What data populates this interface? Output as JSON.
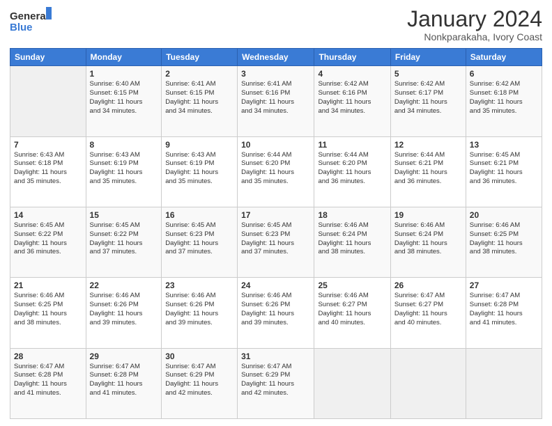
{
  "header": {
    "logo_line1": "General",
    "logo_line2": "Blue",
    "month_title": "January 2024",
    "subtitle": "Nonkparakaha, Ivory Coast"
  },
  "weekdays": [
    "Sunday",
    "Monday",
    "Tuesday",
    "Wednesday",
    "Thursday",
    "Friday",
    "Saturday"
  ],
  "weeks": [
    [
      {
        "day": "",
        "info": ""
      },
      {
        "day": "1",
        "info": "Sunrise: 6:40 AM\nSunset: 6:15 PM\nDaylight: 11 hours\nand 34 minutes."
      },
      {
        "day": "2",
        "info": "Sunrise: 6:41 AM\nSunset: 6:15 PM\nDaylight: 11 hours\nand 34 minutes."
      },
      {
        "day": "3",
        "info": "Sunrise: 6:41 AM\nSunset: 6:16 PM\nDaylight: 11 hours\nand 34 minutes."
      },
      {
        "day": "4",
        "info": "Sunrise: 6:42 AM\nSunset: 6:16 PM\nDaylight: 11 hours\nand 34 minutes."
      },
      {
        "day": "5",
        "info": "Sunrise: 6:42 AM\nSunset: 6:17 PM\nDaylight: 11 hours\nand 34 minutes."
      },
      {
        "day": "6",
        "info": "Sunrise: 6:42 AM\nSunset: 6:18 PM\nDaylight: 11 hours\nand 35 minutes."
      }
    ],
    [
      {
        "day": "7",
        "info": "Sunrise: 6:43 AM\nSunset: 6:18 PM\nDaylight: 11 hours\nand 35 minutes."
      },
      {
        "day": "8",
        "info": "Sunrise: 6:43 AM\nSunset: 6:19 PM\nDaylight: 11 hours\nand 35 minutes."
      },
      {
        "day": "9",
        "info": "Sunrise: 6:43 AM\nSunset: 6:19 PM\nDaylight: 11 hours\nand 35 minutes."
      },
      {
        "day": "10",
        "info": "Sunrise: 6:44 AM\nSunset: 6:20 PM\nDaylight: 11 hours\nand 35 minutes."
      },
      {
        "day": "11",
        "info": "Sunrise: 6:44 AM\nSunset: 6:20 PM\nDaylight: 11 hours\nand 36 minutes."
      },
      {
        "day": "12",
        "info": "Sunrise: 6:44 AM\nSunset: 6:21 PM\nDaylight: 11 hours\nand 36 minutes."
      },
      {
        "day": "13",
        "info": "Sunrise: 6:45 AM\nSunset: 6:21 PM\nDaylight: 11 hours\nand 36 minutes."
      }
    ],
    [
      {
        "day": "14",
        "info": "Sunrise: 6:45 AM\nSunset: 6:22 PM\nDaylight: 11 hours\nand 36 minutes."
      },
      {
        "day": "15",
        "info": "Sunrise: 6:45 AM\nSunset: 6:22 PM\nDaylight: 11 hours\nand 37 minutes."
      },
      {
        "day": "16",
        "info": "Sunrise: 6:45 AM\nSunset: 6:23 PM\nDaylight: 11 hours\nand 37 minutes."
      },
      {
        "day": "17",
        "info": "Sunrise: 6:45 AM\nSunset: 6:23 PM\nDaylight: 11 hours\nand 37 minutes."
      },
      {
        "day": "18",
        "info": "Sunrise: 6:46 AM\nSunset: 6:24 PM\nDaylight: 11 hours\nand 38 minutes."
      },
      {
        "day": "19",
        "info": "Sunrise: 6:46 AM\nSunset: 6:24 PM\nDaylight: 11 hours\nand 38 minutes."
      },
      {
        "day": "20",
        "info": "Sunrise: 6:46 AM\nSunset: 6:25 PM\nDaylight: 11 hours\nand 38 minutes."
      }
    ],
    [
      {
        "day": "21",
        "info": "Sunrise: 6:46 AM\nSunset: 6:25 PM\nDaylight: 11 hours\nand 38 minutes."
      },
      {
        "day": "22",
        "info": "Sunrise: 6:46 AM\nSunset: 6:26 PM\nDaylight: 11 hours\nand 39 minutes."
      },
      {
        "day": "23",
        "info": "Sunrise: 6:46 AM\nSunset: 6:26 PM\nDaylight: 11 hours\nand 39 minutes."
      },
      {
        "day": "24",
        "info": "Sunrise: 6:46 AM\nSunset: 6:26 PM\nDaylight: 11 hours\nand 39 minutes."
      },
      {
        "day": "25",
        "info": "Sunrise: 6:46 AM\nSunset: 6:27 PM\nDaylight: 11 hours\nand 40 minutes."
      },
      {
        "day": "26",
        "info": "Sunrise: 6:47 AM\nSunset: 6:27 PM\nDaylight: 11 hours\nand 40 minutes."
      },
      {
        "day": "27",
        "info": "Sunrise: 6:47 AM\nSunset: 6:28 PM\nDaylight: 11 hours\nand 41 minutes."
      }
    ],
    [
      {
        "day": "28",
        "info": "Sunrise: 6:47 AM\nSunset: 6:28 PM\nDaylight: 11 hours\nand 41 minutes."
      },
      {
        "day": "29",
        "info": "Sunrise: 6:47 AM\nSunset: 6:28 PM\nDaylight: 11 hours\nand 41 minutes."
      },
      {
        "day": "30",
        "info": "Sunrise: 6:47 AM\nSunset: 6:29 PM\nDaylight: 11 hours\nand 42 minutes."
      },
      {
        "day": "31",
        "info": "Sunrise: 6:47 AM\nSunset: 6:29 PM\nDaylight: 11 hours\nand 42 minutes."
      },
      {
        "day": "",
        "info": ""
      },
      {
        "day": "",
        "info": ""
      },
      {
        "day": "",
        "info": ""
      }
    ]
  ]
}
